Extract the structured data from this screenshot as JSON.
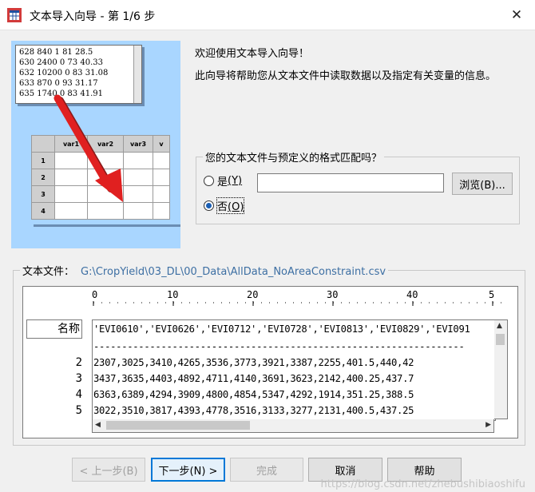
{
  "window": {
    "title": "文本导入向导 - 第 1/6 步",
    "close_glyph": "✕"
  },
  "illustration": {
    "text_lines": [
      "628 840 1 81 28.5",
      "630 2400 0 73 40.33",
      "632 10200 0 83 31.08",
      "633 870 0 93 31.17",
      "635 1740 0 83 41.91"
    ],
    "grid_headers": [
      "var1",
      "var2",
      "var3",
      "v"
    ],
    "grid_rows": [
      "1",
      "2",
      "3",
      "4"
    ]
  },
  "welcome": "欢迎使用文本导入向导！",
  "description": "此向导将帮助您从文本文件中读取数据以及指定有关变量的信息。",
  "format_question": {
    "legend": "您的文本文件与预定义的格式匹配吗？",
    "yes_label": "是",
    "yes_key": "(Y)",
    "no_label": "否",
    "no_key": "(O)",
    "selected": "no",
    "path_value": "",
    "browse_label": "浏览(B)..."
  },
  "file": {
    "label": "文本文件：",
    "path": "G:\\CropYield\\03_DL\\00_Data\\AllData_NoAreaConstraint.csv",
    "ruler": [
      "0",
      "10",
      "20",
      "30",
      "40",
      "5"
    ],
    "name_label": "名称",
    "row_numbers": [
      "2",
      "3",
      "4",
      "5"
    ],
    "lines": [
      "'EVI0610','EVI0626','EVI0712','EVI0728','EVI0813','EVI0829','EVI091",
      "------------------------------------------------------------------",
      "2307,3025,3410,4265,3536,3773,3921,3387,2255,401.5,440,42",
      "3437,3635,4403,4892,4711,4140,3691,3623,2142,400.25,437.7",
      "6363,6389,4294,3909,4800,4854,5347,4292,1914,351.25,388.5",
      "3022,3510,3817,4393,4778,3516,3133,3277,2131,400.5,437.25"
    ]
  },
  "buttons": {
    "back": "< 上一步(B)",
    "next": "下一步(N) >",
    "finish": "完成",
    "cancel": "取消",
    "help": "帮助"
  },
  "watermark": "https://blog.csdn.net/zhebushibiaoshifu"
}
